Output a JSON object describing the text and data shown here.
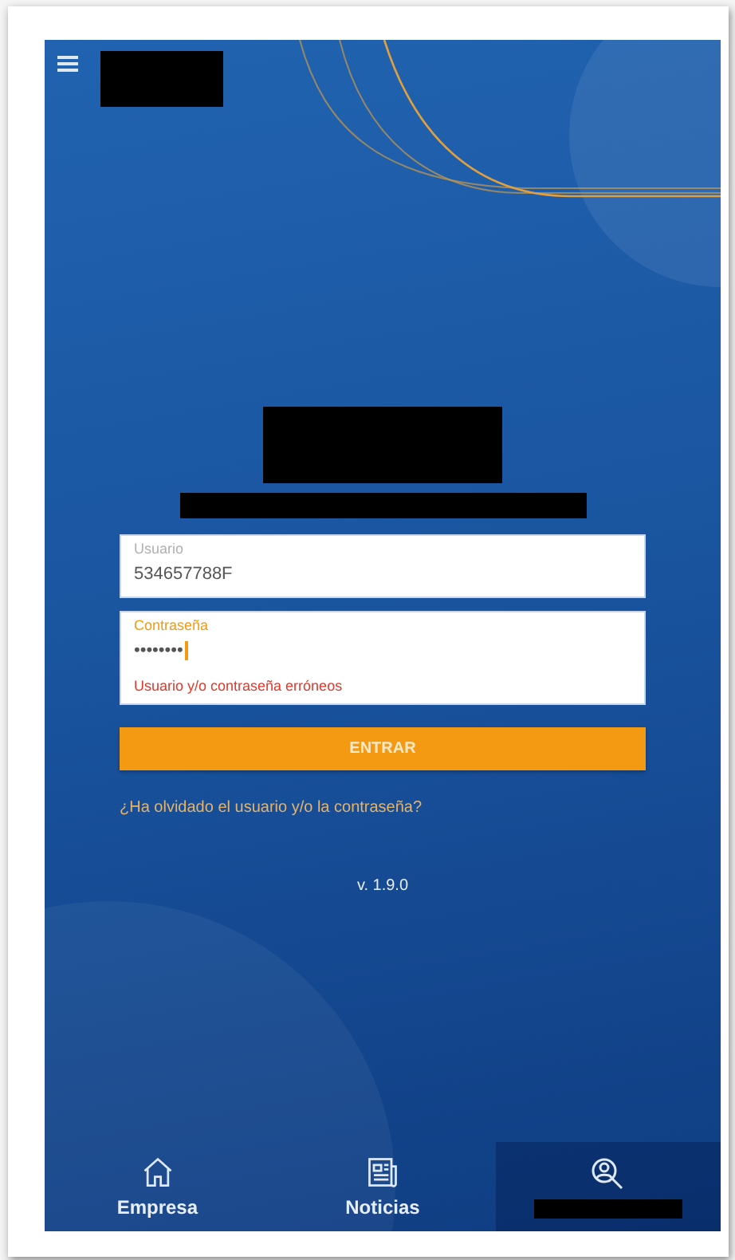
{
  "fields": [
    {
      "label": "Usuario",
      "value": "534657788F",
      "focused": false
    },
    {
      "label": "Contraseña",
      "value": "••••••••",
      "focused": true,
      "error": "Usuario y/o contraseña erróneos"
    }
  ],
  "submit": "ENTRAR",
  "forgot_link": "¿Ha olvidado el usuario y/o la contraseña?",
  "version": "v. 1.9.0",
  "nav": [
    {
      "label": "Empresa",
      "kind": "home",
      "selected": false
    },
    {
      "label": "Noticias",
      "kind": "news",
      "selected": false
    },
    {
      "kind": "search",
      "selected": true
    }
  ]
}
